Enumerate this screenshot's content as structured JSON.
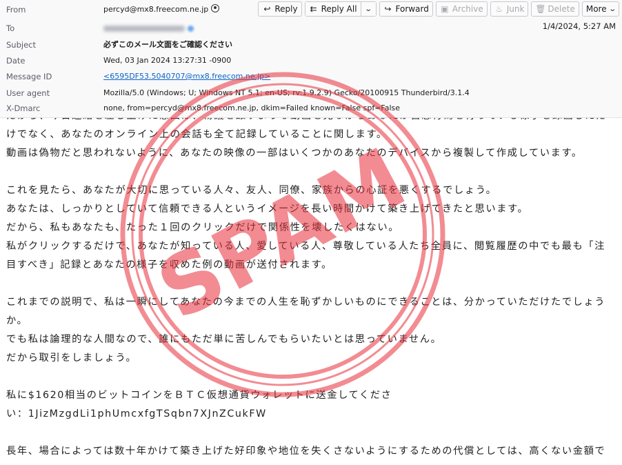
{
  "header": {
    "fields": [
      {
        "label": "From",
        "value": "percyd@mx8.freecom.ne.jp"
      },
      {
        "label": "To",
        "value": "[redacted recipient]"
      },
      {
        "label": "Subject",
        "value": "必ずこのメール文面をご確認ください"
      },
      {
        "label": "Date",
        "value": "Wed, 03 Jan 2024 13:27:31 -0900"
      },
      {
        "label": "Message ID",
        "value": "<6595DF53.5040707@mx8.freecom.ne.jp>"
      },
      {
        "label": "User agent",
        "value": "Mozilla/5.0 (Windows; U; Windows NT 5.1; en-US; rv:1.9.2.9) Gecko/20100915 Thunderbird/3.1.4"
      },
      {
        "label": "X-Dmarc",
        "value": "none, from=percyd@mx8.freecom.ne.jp, dkim=Failed known=False spf=False"
      }
    ],
    "received": "1/4/2024, 5:27 AM"
  },
  "toolbar": {
    "reply": "Reply",
    "reply_all": "Reply All",
    "forward": "Forward",
    "archive": "Archive",
    "junk": "Junk",
    "delete": "Delete",
    "more": "More"
  },
  "body": {
    "lines": [
      "だから、今日連絡を差し上げた意図は、物議を醸すような動画を見ながらあなたが自慰行為を行っている様子を録画しただ",
      "けでなく、あなたのオンライン上の会話も全て記録していることに関します。",
      "動画は偽物だと思われないように、あなたの映像の一部はいくつかのあなたのデバイスから複製して作成しています。",
      "",
      "これを見たら、あなたが大切に思っている人々、友人、同僚、家族からの心証を悪くするでしょう。",
      "あなたは、しっかりとしていて信頼できる人というイメージを長い時間かけて築き上げてきたと思います。",
      "だから、私もあなたも、たった１回のクリックだけで関係性を壊したくはない。",
      "私がクリックするだけで、あなたが知っている人、愛している人、尊敬している人たち全員に、閲覧履歴の中でも最も「注",
      "目すべき」記録とあなたの様子を収めた例の動画が送付されます。",
      "",
      "これまでの説明で、私は一瞬にしてあなたの今までの人生を恥ずかしいものにできることは、分かっていただけたでしょう",
      "か。",
      "でも私は論理的な人間なので、誰にもただ単に苦しんでもらいたいとは思っていません。",
      "だから取引をしましょう。",
      "",
      "私に$1620相当のビットコインをＢＴＣ仮想通貨ウォレットに送金してくださ",
      "い：1JizMzgdLi1phUmcxfgTSqbn7XJnZCukFW",
      "",
      "長年、場合によっては数十年かけて築き上げた好印象や地位を失くさないようにするための代償としては、高くない金額で"
    ]
  },
  "stamp": {
    "text": "SPAM",
    "color": "#e8303a"
  },
  "colors": {
    "link": "#0a63c8",
    "header_bg": "#f9f9fa"
  }
}
